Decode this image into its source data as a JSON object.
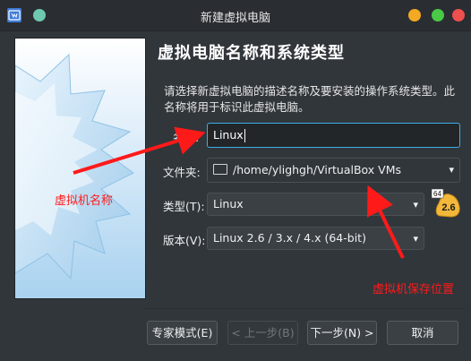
{
  "window": {
    "title": "新建虚拟电脑",
    "colors": {
      "minimize": "#f3a921",
      "maximize": "#49c946",
      "close": "#ef4f4f",
      "pin": "#6ec9b1"
    }
  },
  "page": {
    "heading": "虚拟电脑名称和系统类型",
    "description": "请选择新虚拟电脑的描述名称及要安装的操作系统类型。此名称将用于标识此虚拟电脑。"
  },
  "form": {
    "name_label": "名称:",
    "name_value": "Linux",
    "folder_label": "文件夹:",
    "folder_value": "/home/ylighgh/VirtualBox VMs",
    "type_label": "类型(T):",
    "type_value": "Linux",
    "version_label": "版本(V):",
    "version_value": "Linux 2.6 / 3.x / 4.x (64-bit)",
    "os_badge": {
      "top": "64",
      "main": "2.6"
    }
  },
  "buttons": {
    "expert": "专家模式(E)",
    "back": "< 上一步(B)",
    "next": "下一步(N) >",
    "cancel": "取消"
  },
  "annotations": {
    "vm_name": "虚拟机名称",
    "vm_location": "虚拟机保存位置",
    "color": "#ff1a1a"
  },
  "icons": [
    "virtualbox-app-icon",
    "folder-icon",
    "chevron-down-icon",
    "linux-os-icon"
  ]
}
